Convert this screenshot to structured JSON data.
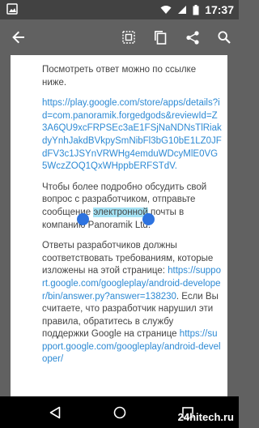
{
  "status_bar": {
    "time": "17:37"
  },
  "article": {
    "p1": "Посмотреть ответ можно по ссылке ниже.",
    "link1": "https://play.google.com/store/apps/details?id=com.panoramik.forgedgods&reviewId=Z3A6QU9xcFRPSEc3aE1FSjNaNDNsTlRiakdyYnhJakdBVkpySmNibFl3bG10bE1LZ0JFdFV3c1JSYnVRWHg4emduWDcyMlE0VG5WczZOQ1QxWHppbERFSTdV.",
    "p2_before": "Чтобы более подробно обсудить свой вопрос с разработчиком, отправьте сообщение ",
    "p2_selected": "электронной",
    "p2_after": " почты в компанию Panoramik Ltd.",
    "p3": "Ответы разработчиков должны соответствовать требованиям, которые изложены на этой странице:",
    "link2": "https://support.google.com/googleplay/android-developer/bin/answer.py?answer=138230",
    "p3_after": ". Если Вы считаете, что разработчик нарушил эти правила, обратитесь в службу поддержки Google на странице",
    "link3": "https://support.google.com/googleplay/android-developer/"
  },
  "watermark": "24hitech.ru",
  "icons": {
    "status_left": "image-icon",
    "wifi": "wifi-icon",
    "signal": "cell-signal-icon",
    "battery": "battery-icon",
    "back": "arrow-back-icon",
    "select_all": "select-all-icon",
    "copy": "copy-icon",
    "share": "share-icon",
    "search": "search-icon",
    "nav_back": "nav-back-icon",
    "nav_home": "nav-home-icon",
    "nav_recents": "nav-recents-icon"
  }
}
